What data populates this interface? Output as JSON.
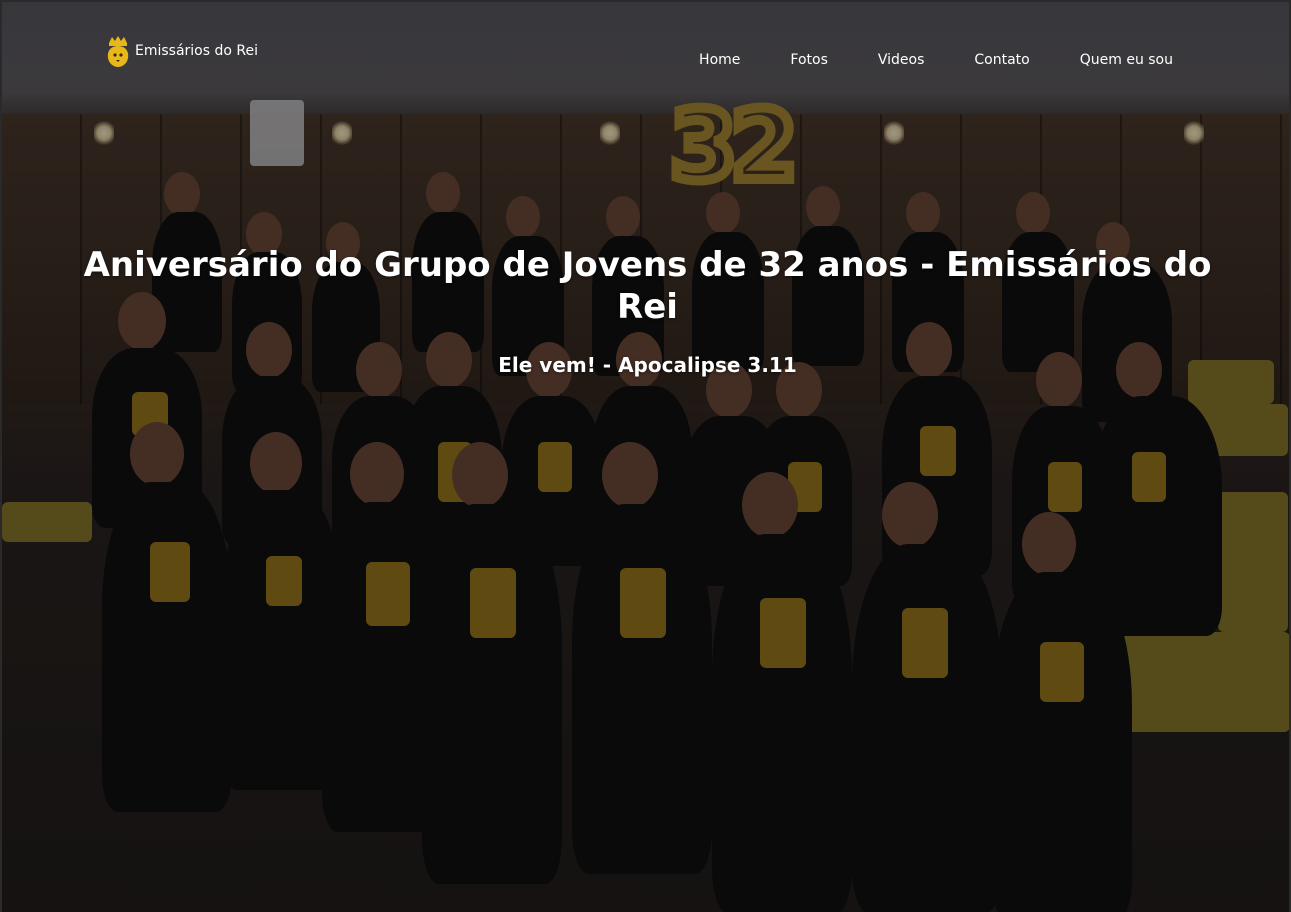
{
  "nav": {
    "brand_label": "Emissários do Rei",
    "brand_icon": "lion-crown-icon",
    "items": [
      {
        "label": "Home"
      },
      {
        "label": "Fotos"
      },
      {
        "label": "Videos"
      },
      {
        "label": "Contato"
      },
      {
        "label": "Quem eu sou"
      }
    ]
  },
  "hero": {
    "title": "Aniversário do Grupo de Jovens de 32 anos - Emissários do Rei",
    "subtitle": "Ele vem! - Apocalipse 3.11",
    "balloon_text": "32"
  },
  "colors": {
    "text": "#ffffff",
    "brand_gold": "#e8b81a",
    "shirt_print": "#9a7a1e"
  }
}
